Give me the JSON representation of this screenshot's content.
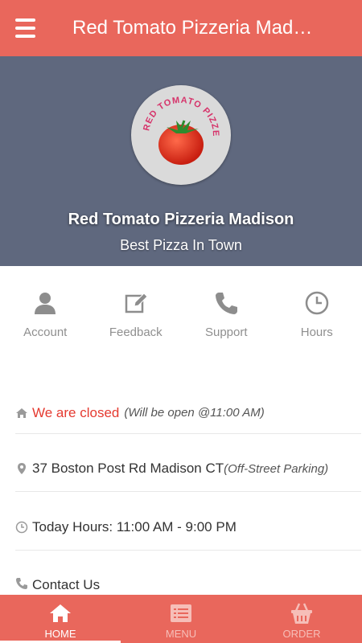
{
  "header": {
    "title": "Red Tomato Pizzeria Madison",
    "menu_icon": "hamburger-menu-icon"
  },
  "hero": {
    "logo_text": "THE RED TOMATO PIZZERIA",
    "name": "Red Tomato Pizzeria Madison",
    "tagline": "Best Pizza In Town"
  },
  "actions": [
    {
      "label": "Account",
      "icon": "user-icon"
    },
    {
      "label": "Feedback",
      "icon": "edit-icon"
    },
    {
      "label": "Support",
      "icon": "phone-icon"
    },
    {
      "label": "Hours",
      "icon": "clock-icon"
    }
  ],
  "info": {
    "status": "We are closed",
    "status_note": "(Will be open @11:00 AM)",
    "address": "37 Boston Post Rd Madison CT",
    "address_note": "(Off-Street Parking)",
    "hours": "Today Hours: 11:00 AM - 9:00 PM",
    "contact": "Contact Us"
  },
  "tabs": [
    {
      "label": "HOME",
      "icon": "home-icon",
      "active": true
    },
    {
      "label": "MENU",
      "icon": "menu-list-icon",
      "active": false
    },
    {
      "label": "ORDER",
      "icon": "basket-icon",
      "active": false
    }
  ],
  "colors": {
    "primary": "#E9675C",
    "hero_bg": "#5F687E",
    "closed": "#E53A30"
  }
}
